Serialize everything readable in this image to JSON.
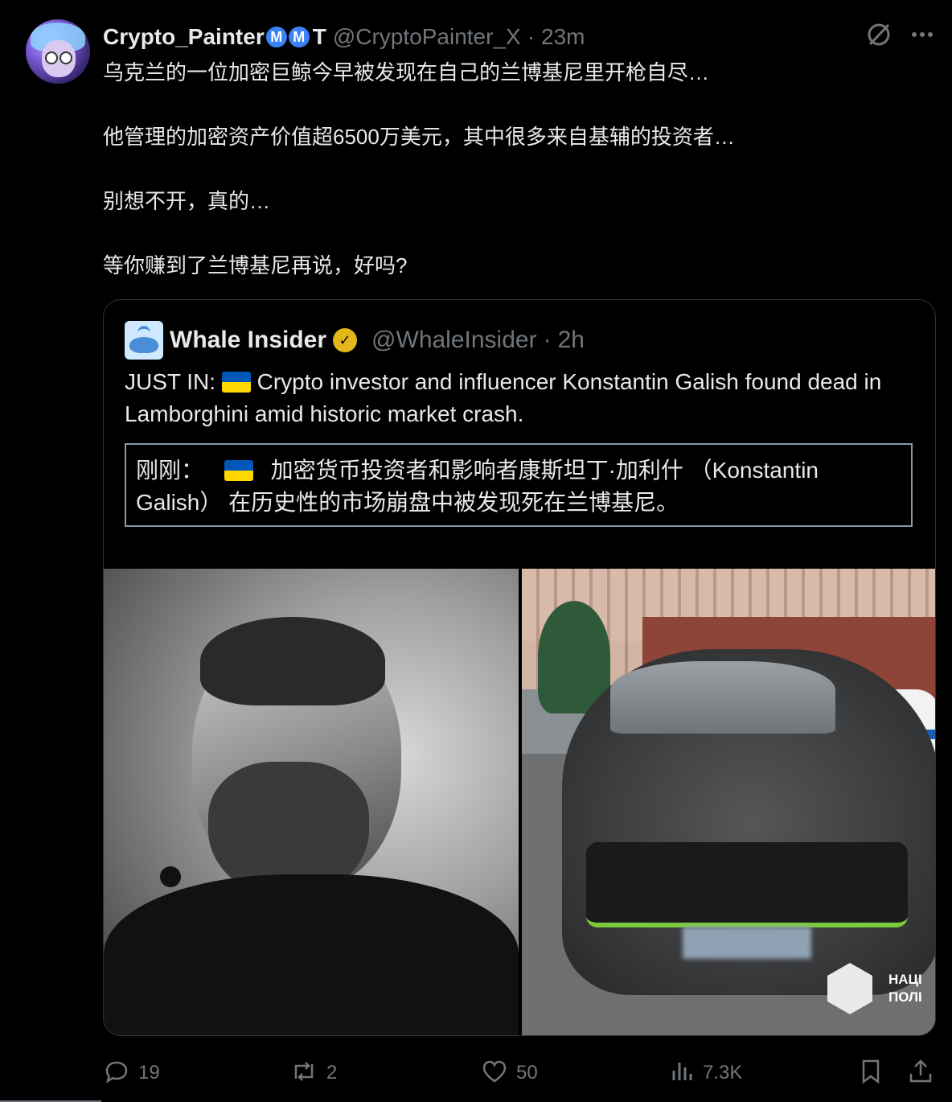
{
  "post": {
    "author_name": "Crypto_Painter",
    "badges": [
      "M",
      "M"
    ],
    "badge_extra": "T",
    "handle": "@CryptoPainter_X",
    "separator": "·",
    "time": "23m",
    "icons": [
      "grok-icon",
      "more-icon"
    ],
    "paragraphs": [
      "乌克兰的一位加密巨鲸今早被发现在自己的兰博基尼里开枪自尽…",
      "他管理的加密资产价值超6500万美元，其中很多来自基辅的投资者…",
      "别想不开，真的…",
      "等你赚到了兰博基尼再说，好吗?"
    ]
  },
  "quote": {
    "author_name": "Whale Insider",
    "handle": "@WhaleInsider",
    "separator": "·",
    "time": "2h",
    "text_prefix": "JUST IN:",
    "text_body": "Crypto investor and influencer Konstantin Galish found dead in Lamborghini amid historic market crash.",
    "translation_prefix": "刚刚：",
    "translation_body": "加密货币投资者和影响者康斯坦丁·加利什 （Konstantin Galish） 在历史性的市场崩盘中被发现死在兰博基尼。",
    "media": {
      "right_logo_text_line1": "НАЦІ",
      "right_logo_text_line2": "ПОЛІ"
    }
  },
  "actions": {
    "replies": "19",
    "reposts": "2",
    "likes": "50",
    "views": "7.3K"
  },
  "colors": {
    "background": "#000000",
    "text": "#e7e9ea",
    "muted": "#71767b",
    "badge_blue": "#3b82f6",
    "verified_gold": "#e2b719",
    "flag_blue": "#0057b7",
    "flag_yellow": "#ffd700"
  }
}
